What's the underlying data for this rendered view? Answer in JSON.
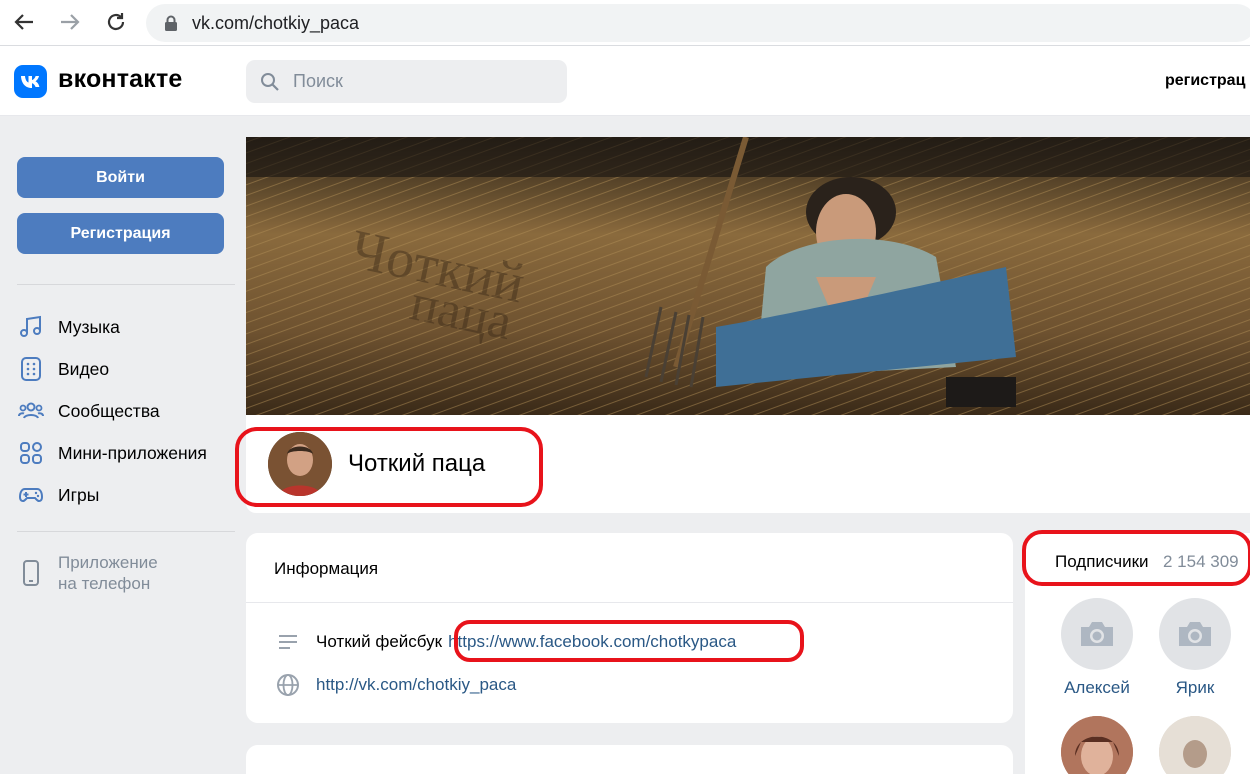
{
  "browser": {
    "url": "vk.com/chotkiy_paca"
  },
  "header": {
    "logo_text": "вконтакте",
    "search_placeholder": "Поиск",
    "register_link": "регистрац"
  },
  "sidebar": {
    "login_button": "Войти",
    "register_button": "Регистрация",
    "items": [
      {
        "label": "Музыка",
        "icon": "music-icon"
      },
      {
        "label": "Видео",
        "icon": "video-icon"
      },
      {
        "label": "Сообщества",
        "icon": "communities-icon"
      },
      {
        "label": "Мини-приложения",
        "icon": "mini-apps-icon"
      },
      {
        "label": "Игры",
        "icon": "gamepad-icon"
      }
    ],
    "app_link": {
      "line1": "Приложение",
      "line2": "на телефон",
      "icon": "phone-icon"
    }
  },
  "profile": {
    "name": "Чоткий паца"
  },
  "info": {
    "title": "Информация",
    "description_label": "Чоткий фейсбук",
    "facebook_link": "https://www.facebook.com/chotkypaca",
    "site_link": "http://vk.com/chotkiy_paca"
  },
  "followers": {
    "title": "Подписчики",
    "count": "2 154 309",
    "people": [
      {
        "name": "Алексей"
      },
      {
        "name": "Ярик"
      }
    ]
  },
  "colors": {
    "vk_blue": "#0077ff",
    "button_blue": "#4d7cbf",
    "link": "#2a5885",
    "highlight_red": "#e8131b"
  }
}
